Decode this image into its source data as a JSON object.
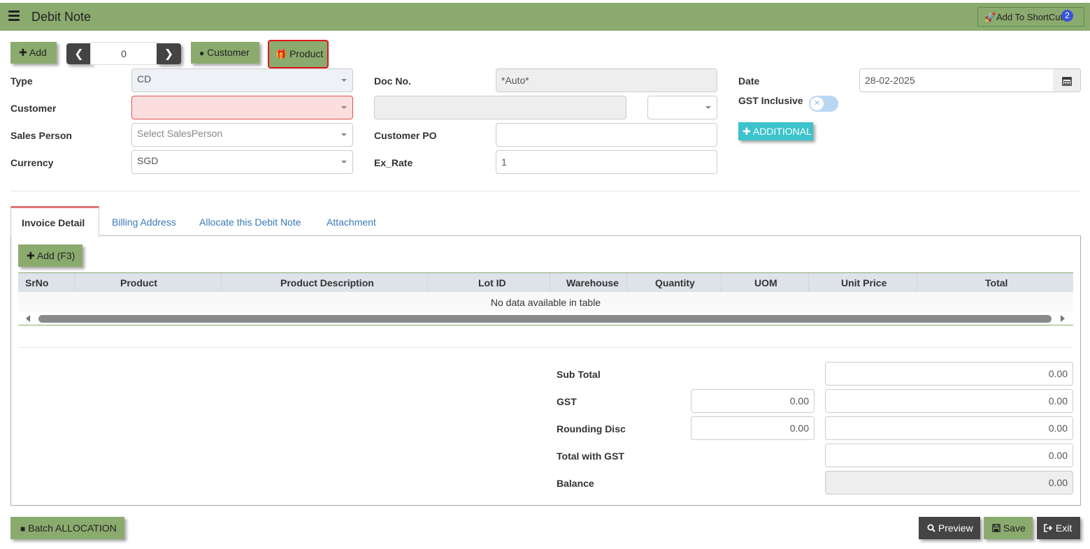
{
  "header": {
    "title": "Debit Note",
    "shortcut_label": "Add To ShortCut",
    "shortcut_badge": "2"
  },
  "toolbar": {
    "add_label": "Add",
    "record_index": "0",
    "customer_label": "Customer",
    "product_label": "Product"
  },
  "form": {
    "type_label": "Type",
    "type_value": "CD",
    "customer_label": "Customer",
    "customer_value": "",
    "sales_person_label": "Sales Person",
    "sales_person_placeholder": "Select SalesPerson",
    "currency_label": "Currency",
    "currency_value": "SGD",
    "doc_no_label": "Doc No.",
    "doc_no_value": "*Auto*",
    "customer_po_label": "Customer PO",
    "customer_po_value": "",
    "ex_rate_label": "Ex_Rate",
    "ex_rate_value": "1",
    "date_label": "Date",
    "date_value": "28-02-2025",
    "gst_inclusive_label": "GST Inclusive",
    "additional_label": "ADDITIONAL"
  },
  "tabs": [
    {
      "label": "Invoice Detail",
      "active": true
    },
    {
      "label": "Billing Address"
    },
    {
      "label": "Allocate this Debit Note"
    },
    {
      "label": "Attachment"
    }
  ],
  "detail": {
    "add_label": "Add (F3)",
    "columns": [
      "SrNo",
      "Product",
      "Product Description",
      "Lot ID",
      "Warehouse",
      "Quantity",
      "UOM",
      "Unit Price",
      "Total"
    ],
    "empty_text": "No data available in table"
  },
  "totals": {
    "sub_total_label": "Sub Total",
    "sub_total": "0.00",
    "gst_label": "GST",
    "gst_rate": "0.00",
    "gst_amount": "0.00",
    "rounding_label": "Rounding Disc",
    "rounding_rate": "0.00",
    "rounding_amount": "0.00",
    "total_gst_label": "Total with GST",
    "total_gst": "0.00",
    "balance_label": "Balance",
    "balance": "0.00"
  },
  "footer": {
    "batch_label": "Batch ALLOCATION",
    "preview_label": "Preview",
    "save_label": "Save",
    "exit_label": "Exit"
  },
  "colors": {
    "header_bg": "#8bab6e",
    "dark_button": "#444444",
    "teal_button": "#3cc3cc",
    "error_field": "#fddede",
    "highlight_border": "#e0161b"
  }
}
